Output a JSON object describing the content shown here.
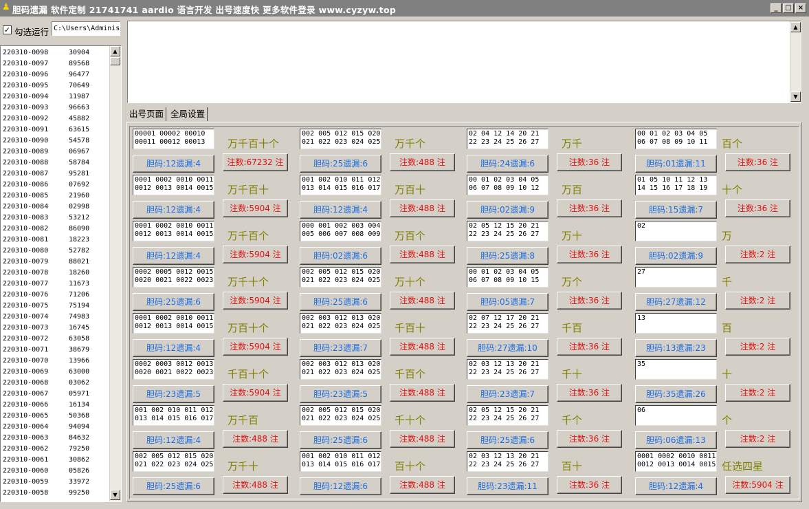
{
  "window": {
    "title": "胆码遗漏  软件定制 21741741  aardio 语言开发  出号速度快  更多软件登录 www.cyzyw.top",
    "minimize": "_",
    "maximize": "□",
    "close": "×"
  },
  "left": {
    "checkbox_checked": true,
    "checkbox_mark": "✓",
    "checkbox_label": "勾选运行",
    "path_value": "C:\\Users\\Adminis",
    "rows": [
      {
        "id": "220310-0098",
        "num": "30904"
      },
      {
        "id": "220310-0097",
        "num": "89568"
      },
      {
        "id": "220310-0096",
        "num": "96477"
      },
      {
        "id": "220310-0095",
        "num": "70649"
      },
      {
        "id": "220310-0094",
        "num": "11987"
      },
      {
        "id": "220310-0093",
        "num": "96663"
      },
      {
        "id": "220310-0092",
        "num": "45882"
      },
      {
        "id": "220310-0091",
        "num": "63615"
      },
      {
        "id": "220310-0090",
        "num": "54578"
      },
      {
        "id": "220310-0089",
        "num": "06967"
      },
      {
        "id": "220310-0088",
        "num": "58784"
      },
      {
        "id": "220310-0087",
        "num": "95281"
      },
      {
        "id": "220310-0086",
        "num": "07692"
      },
      {
        "id": "220310-0085",
        "num": "21960"
      },
      {
        "id": "220310-0084",
        "num": "02998"
      },
      {
        "id": "220310-0083",
        "num": "53212"
      },
      {
        "id": "220310-0082",
        "num": "86090"
      },
      {
        "id": "220310-0081",
        "num": "18223"
      },
      {
        "id": "220310-0080",
        "num": "52782"
      },
      {
        "id": "220310-0079",
        "num": "88021"
      },
      {
        "id": "220310-0078",
        "num": "18260"
      },
      {
        "id": "220310-0077",
        "num": "11673"
      },
      {
        "id": "220310-0076",
        "num": "71206"
      },
      {
        "id": "220310-0075",
        "num": "75194"
      },
      {
        "id": "220310-0074",
        "num": "74983"
      },
      {
        "id": "220310-0073",
        "num": "16745"
      },
      {
        "id": "220310-0072",
        "num": "63058"
      },
      {
        "id": "220310-0071",
        "num": "38679"
      },
      {
        "id": "220310-0070",
        "num": "13966"
      },
      {
        "id": "220310-0069",
        "num": "63000"
      },
      {
        "id": "220310-0068",
        "num": "03062"
      },
      {
        "id": "220310-0067",
        "num": "05971"
      },
      {
        "id": "220310-0066",
        "num": "16134"
      },
      {
        "id": "220310-0065",
        "num": "50368"
      },
      {
        "id": "220310-0064",
        "num": "94094"
      },
      {
        "id": "220310-0063",
        "num": "84632"
      },
      {
        "id": "220310-0062",
        "num": "79250"
      },
      {
        "id": "220310-0061",
        "num": "30862"
      },
      {
        "id": "220310-0060",
        "num": "05826"
      },
      {
        "id": "220310-0059",
        "num": "33972"
      },
      {
        "id": "220310-0058",
        "num": "99250"
      }
    ]
  },
  "tabs": [
    "出号页面",
    "全局设置"
  ],
  "scroll_arrows": {
    "up": "▲",
    "down": "▼"
  },
  "grid": [
    [
      {
        "numbers": "00001 00002 00010\n00011 00012 00013",
        "label": "万千百十个",
        "dan": "胆码:12遗漏:4",
        "zhu": "注数:67232 注"
      },
      {
        "numbers": "002 005 012 015 020\n021 022 023 024 025",
        "label": "万千个",
        "dan": "胆码:25遗漏:6",
        "zhu": "注数:488 注"
      },
      {
        "numbers": "02 04 12 14 20 21\n22 23 24 25 26 27",
        "label": "万千",
        "dan": "胆码:24遗漏:6",
        "zhu": "注数:36 注"
      },
      {
        "numbers": "00 01 02 03 04 05\n06 07 08 09 10 11",
        "label": "百个",
        "dan": "胆码:01遗漏:11",
        "zhu": "注数:36 注"
      }
    ],
    [
      {
        "numbers": "0001 0002 0010 0011\n0012 0013 0014 0015",
        "label": "万千百十",
        "dan": "胆码:12遗漏:4",
        "zhu": "注数:5904 注"
      },
      {
        "numbers": "001 002 010 011 012\n013 014 015 016 017",
        "label": "万百十",
        "dan": "胆码:12遗漏:4",
        "zhu": "注数:488 注"
      },
      {
        "numbers": "00 01 02 03 04 05\n06 07 08 09 10 12",
        "label": "万百",
        "dan": "胆码:02遗漏:9",
        "zhu": "注数:36 注"
      },
      {
        "numbers": "01 05 10 11 12 13\n14 15 16 17 18 19",
        "label": "十个",
        "dan": "胆码:15遗漏:7",
        "zhu": "注数:36 注"
      }
    ],
    [
      {
        "numbers": "0001 0002 0010 0011\n0012 0013 0014 0015",
        "label": "万千百个",
        "dan": "胆码:12遗漏:4",
        "zhu": "注数:5904 注"
      },
      {
        "numbers": "000 001 002 003 004\n005 006 007 008 009",
        "label": "万百个",
        "dan": "胆码:02遗漏:6",
        "zhu": "注数:488 注"
      },
      {
        "numbers": "02 05 12 15 20 21\n22 23 24 25 26 27",
        "label": "万十",
        "dan": "胆码:25遗漏:8",
        "zhu": "注数:36 注"
      },
      {
        "numbers": "02",
        "label": "万",
        "dan": "胆码:02遗漏:9",
        "zhu": "注数:2 注"
      }
    ],
    [
      {
        "numbers": "0002 0005 0012 0015\n0020 0021 0022 0023",
        "label": "万千十个",
        "dan": "胆码:25遗漏:6",
        "zhu": "注数:5904 注"
      },
      {
        "numbers": "002 005 012 015 020\n021 022 023 024 025",
        "label": "万十个",
        "dan": "胆码:25遗漏:6",
        "zhu": "注数:488 注"
      },
      {
        "numbers": "00 01 02 03 04 05\n06 07 08 09 10 15",
        "label": "万个",
        "dan": "胆码:05遗漏:7",
        "zhu": "注数:36 注"
      },
      {
        "numbers": "27",
        "label": "千",
        "dan": "胆码:27遗漏:12",
        "zhu": "注数:2 注"
      }
    ],
    [
      {
        "numbers": "0001 0002 0010 0011\n0012 0013 0014 0015",
        "label": "万百十个",
        "dan": "胆码:12遗漏:4",
        "zhu": "注数:5904 注"
      },
      {
        "numbers": "002 003 012 013 020\n021 022 023 024 025",
        "label": "千百十",
        "dan": "胆码:23遗漏:7",
        "zhu": "注数:488 注"
      },
      {
        "numbers": "02 07 12 17 20 21\n22 23 24 25 26 27",
        "label": "千百",
        "dan": "胆码:27遗漏:10",
        "zhu": "注数:36 注"
      },
      {
        "numbers": "13",
        "label": "百",
        "dan": "胆码:13遗漏:23",
        "zhu": "注数:2 注"
      }
    ],
    [
      {
        "numbers": "0002 0003 0012 0013\n0020 0021 0022 0023",
        "label": "千百十个",
        "dan": "胆码:23遗漏:5",
        "zhu": "注数:5904 注"
      },
      {
        "numbers": "002 003 012 013 020\n021 022 023 024 025",
        "label": "千百个",
        "dan": "胆码:23遗漏:5",
        "zhu": "注数:488 注"
      },
      {
        "numbers": "02 03 12 13 20 21\n22 23 24 25 26 27",
        "label": "千十",
        "dan": "胆码:23遗漏:7",
        "zhu": "注数:36 注"
      },
      {
        "numbers": "35",
        "label": "十",
        "dan": "胆码:35遗漏:26",
        "zhu": "注数:2 注"
      }
    ],
    [
      {
        "numbers": "001 002 010 011 012\n013 014 015 016 017",
        "label": "万千百",
        "dan": "胆码:12遗漏:4",
        "zhu": "注数:488 注"
      },
      {
        "numbers": "002 005 012 015 020\n021 022 023 024 025",
        "label": "千十个",
        "dan": "胆码:25遗漏:6",
        "zhu": "注数:488 注"
      },
      {
        "numbers": "02 05 12 15 20 21\n22 23 24 25 26 27",
        "label": "千个",
        "dan": "胆码:25遗漏:6",
        "zhu": "注数:36 注"
      },
      {
        "numbers": "06",
        "label": "个",
        "dan": "胆码:06遗漏:13",
        "zhu": "注数:2 注"
      }
    ],
    [
      {
        "numbers": "002 005 012 015 020\n021 022 023 024 025",
        "label": "万千十",
        "dan": "胆码:25遗漏:6",
        "zhu": "注数:488 注"
      },
      {
        "numbers": "001 002 010 011 012\n013 014 015 016 017",
        "label": "百十个",
        "dan": "胆码:12遗漏:6",
        "zhu": "注数:488 注"
      },
      {
        "numbers": "02 03 12 13 20 21\n22 23 24 25 26 27",
        "label": "百十",
        "dan": "胆码:23遗漏:11",
        "zhu": "注数:36 注"
      },
      {
        "numbers": "0001 0002 0010 0011\n0012 0013 0014 0015",
        "label": "任选四星",
        "dan": "胆码:12遗漏:4",
        "zhu": "注数:5904 注"
      }
    ]
  ]
}
